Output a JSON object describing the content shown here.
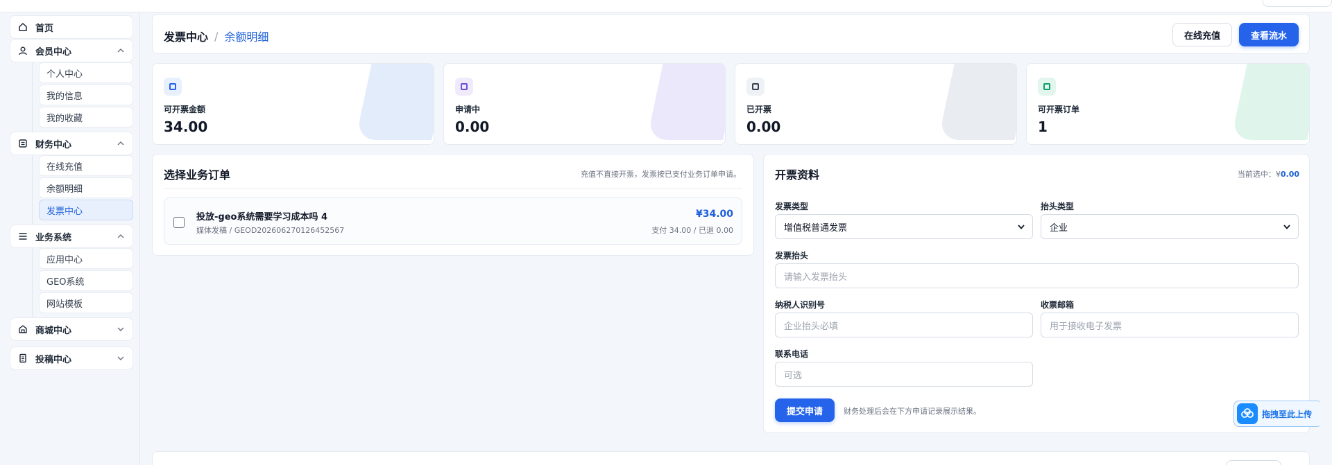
{
  "sidebar": {
    "items": [
      {
        "label": "首页",
        "icon": "home-icon"
      },
      {
        "label": "会员中心",
        "icon": "user-icon",
        "expanded": true,
        "children": [
          "个人中心",
          "我的信息",
          "我的收藏"
        ]
      },
      {
        "label": "财务中心",
        "icon": "ledger-icon",
        "expanded": true,
        "children": [
          "在线充值",
          "余额明细",
          "发票中心"
        ]
      },
      {
        "label": "业务系统",
        "icon": "menu-icon",
        "expanded": true,
        "children": [
          "应用中心",
          "GEO系统",
          "网站模板"
        ]
      },
      {
        "label": "商城中心",
        "icon": "shop-icon",
        "expanded": false
      },
      {
        "label": "投稿中心",
        "icon": "document-icon",
        "expanded": false
      }
    ],
    "active_child": "发票中心"
  },
  "header": {
    "breadcrumb_root": "发票中心",
    "breadcrumb_sep": "/",
    "breadcrumb_current": "余额明细",
    "recharge_button": "在线充值",
    "flow_button": "查看流水"
  },
  "stats": [
    {
      "label": "可开票金额",
      "value": "34.00",
      "color": "#2563eb",
      "blob": "#e3ecfb"
    },
    {
      "label": "申请中",
      "value": "0.00",
      "color": "#6d4fd8",
      "blob": "#ebe8fb"
    },
    {
      "label": "已开票",
      "value": "0.00",
      "color": "#374151",
      "blob": "#e9edf2"
    },
    {
      "label": "可开票订单",
      "value": "1",
      "color": "#0f9f6e",
      "blob": "#dff5ec"
    }
  ],
  "orders": {
    "title": "选择业务订单",
    "note": "充值不直接开票，发票按已支付业务订单申请。",
    "items": [
      {
        "title": "投放-geo系统需要学习成本吗 4",
        "sub": "媒体发稿 / GEOD202606270126452567",
        "amount": "¥34.00",
        "paid": "支付 34.00 / 已退 0.00"
      }
    ]
  },
  "invoice": {
    "title": "开票资料",
    "selected_prefix": "当前选中：¥",
    "selected_value": "0.00",
    "type_label": "发票类型",
    "type_value": "增值税普通发票",
    "head_type_label": "抬头类型",
    "head_type_value": "企业",
    "head_label": "发票抬头",
    "head_placeholder": "请输入发票抬头",
    "tax_label": "纳税人识别号",
    "tax_placeholder": "企业抬头必填",
    "email_label": "收票邮箱",
    "email_placeholder": "用于接收电子发票",
    "phone_label": "联系电话",
    "phone_placeholder": "可选",
    "submit": "提交申请",
    "submit_note": "财务处理后会在下方申请记录展示结果。"
  },
  "upload_float": {
    "label": "拖拽至此上传",
    "icon": "cloud-upload-icon"
  },
  "colors": {
    "primary": "#2563eb",
    "accent_text": "#1d5fd8",
    "background": "#f3f6fa"
  }
}
